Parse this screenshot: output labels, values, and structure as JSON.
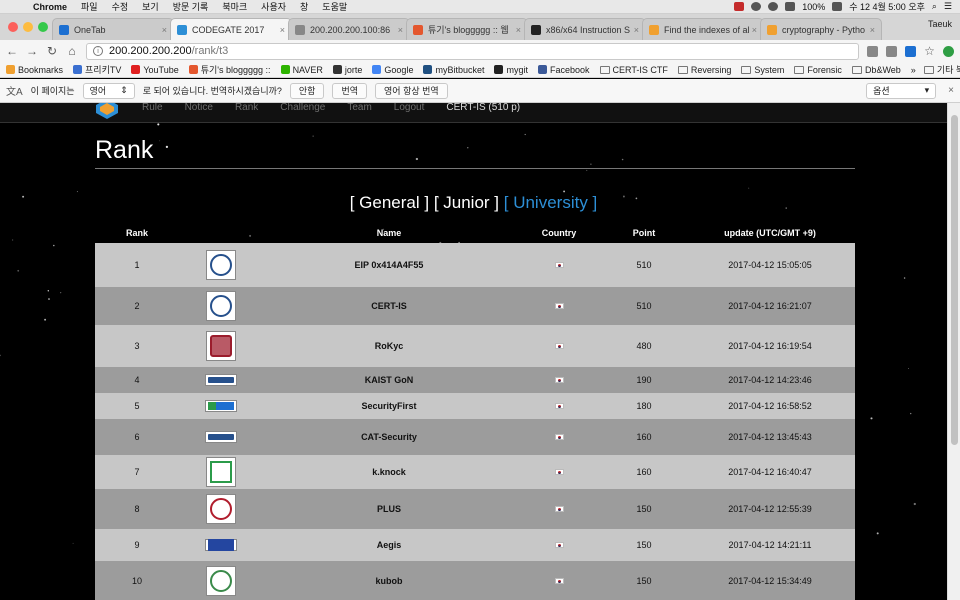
{
  "menubar": {
    "app": "Chrome",
    "items": [
      "파일",
      "수정",
      "보기",
      "방문 기록",
      "북마크",
      "사용자",
      "창",
      "도움말"
    ],
    "battery": "100%",
    "clock": "수 12 4월 5:00 오후"
  },
  "tabs": [
    {
      "label": "OneTab",
      "color": "#1c6fd1",
      "active": false
    },
    {
      "label": "CODEGATE 2017",
      "color": "#2d8fd6",
      "active": true
    },
    {
      "label": "200.200.200.100:86",
      "color": "#888888",
      "active": false
    },
    {
      "label": "튜기's bloggggg :: 웹",
      "color": "#e4572e",
      "active": false
    },
    {
      "label": "x86/x64 Instruction S",
      "color": "#222222",
      "active": false
    },
    {
      "label": "Find the indexes of al",
      "color": "#f0a030",
      "active": false
    },
    {
      "label": "cryptography - Pytho",
      "color": "#f0a030",
      "active": false
    }
  ],
  "profile": "Taeuk",
  "omnibox": {
    "host": "200.200.200.200",
    "path": "/rank/t3"
  },
  "bookmarks": [
    {
      "label": "Bookmarks",
      "icon": "star-icon"
    },
    {
      "label": "프리키TV",
      "icon": "tv-icon"
    },
    {
      "label": "YouTube",
      "icon": "youtube-icon"
    },
    {
      "label": "튜기's bloggggg ::",
      "icon": "blog-icon"
    },
    {
      "label": "NAVER",
      "icon": "naver-icon"
    },
    {
      "label": "jorte",
      "icon": "jorte-icon"
    },
    {
      "label": "Google",
      "icon": "google-icon"
    },
    {
      "label": "myBitbucket",
      "icon": "bitbucket-icon"
    },
    {
      "label": "mygit",
      "icon": "github-icon"
    },
    {
      "label": "Facebook",
      "icon": "facebook-icon"
    },
    {
      "label": "CERT-IS CTF",
      "icon": "folder-icon"
    },
    {
      "label": "Reversing",
      "icon": "folder-icon"
    },
    {
      "label": "System",
      "icon": "folder-icon"
    },
    {
      "label": "Forensic",
      "icon": "folder-icon"
    },
    {
      "label": "Db&Web",
      "icon": "folder-icon"
    }
  ],
  "bookmarks_more": "»",
  "bookmarks_other": "기타 북마크",
  "translate": {
    "prefix": "이 페이지는",
    "language": "영어",
    "suffix": "로 되어 있습니다. 번역하시겠습니까?",
    "never": "안함",
    "translate": "번역",
    "always": "영어 항상 번역",
    "options": "옵션",
    "close": "×"
  },
  "site": {
    "nav": [
      "Rule",
      "Notice",
      "Rank",
      "Challenge",
      "Team",
      "Logout"
    ],
    "team": "CERT-IS (510 p)"
  },
  "page": {
    "title": "Rank",
    "filters": [
      {
        "label": "[ General ]",
        "active": false
      },
      {
        "label": "[ Junior ]",
        "active": false
      },
      {
        "label": "[ University ]",
        "active": true
      }
    ]
  },
  "table": {
    "headers": {
      "rank": "Rank",
      "name": "Name",
      "country": "Country",
      "point": "Point",
      "update": "update (UTC/GMT +9)"
    },
    "rows": [
      {
        "rank": "1",
        "name": "EIP 0x414A4F55",
        "point": "510",
        "update": "2017-04-12 15:05:05",
        "logo": "circle"
      },
      {
        "rank": "2",
        "name": "CERT-IS",
        "point": "510",
        "update": "2017-04-12 16:21:07",
        "logo": "circle"
      },
      {
        "rank": "3",
        "name": "RoKyc",
        "point": "480",
        "update": "2017-04-12 16:19:54",
        "logo": "shield"
      },
      {
        "rank": "4",
        "name": "KAIST GoN",
        "point": "190",
        "update": "2017-04-12 14:23:46",
        "logo": "rect"
      },
      {
        "rank": "5",
        "name": "SecurityFirst",
        "point": "180",
        "update": "2017-04-12 16:58:52",
        "logo": "sch"
      },
      {
        "rank": "6",
        "name": "CAT-Security",
        "point": "160",
        "update": "2017-04-12 13:45:43",
        "logo": "rect"
      },
      {
        "rank": "7",
        "name": "k.knock",
        "point": "160",
        "update": "2017-04-12 16:40:47",
        "logo": "kgu"
      },
      {
        "rank": "8",
        "name": "PLUS",
        "point": "150",
        "update": "2017-04-12 12:55:39",
        "logo": "plus"
      },
      {
        "rank": "9",
        "name": "Aegis",
        "point": "150",
        "update": "2017-04-12 14:21:11",
        "logo": "dku"
      },
      {
        "rank": "10",
        "name": "kubob",
        "point": "150",
        "update": "2017-04-12 15:34:49",
        "logo": "green"
      }
    ]
  }
}
